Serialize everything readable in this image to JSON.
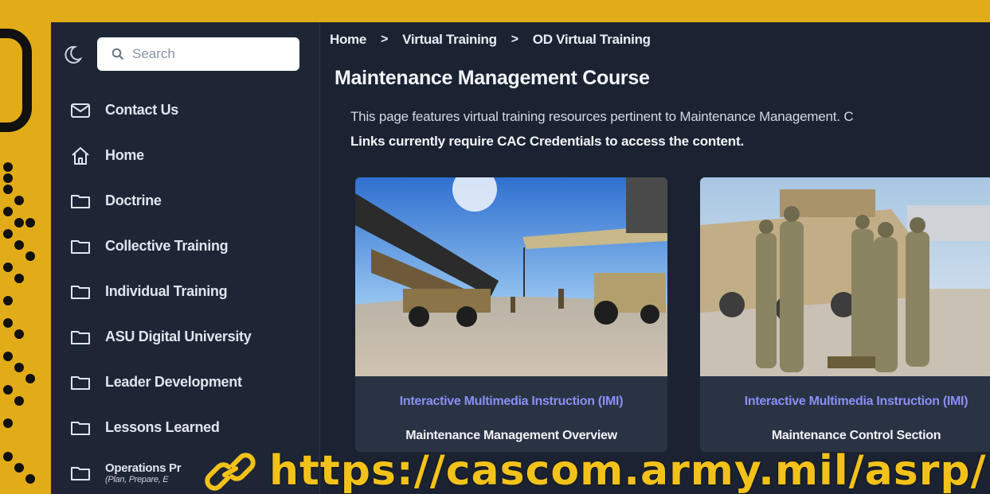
{
  "search": {
    "placeholder": "Search"
  },
  "icons": {
    "theme": "moon-icon",
    "search": "search-icon",
    "contact": "envelope-icon",
    "home": "home-icon",
    "folder": "folder-icon",
    "link": "link-icon"
  },
  "sidebar": {
    "items": [
      {
        "label": "Contact Us",
        "icon": "envelope-icon"
      },
      {
        "label": "Home",
        "icon": "home-icon"
      },
      {
        "label": "Doctrine",
        "icon": "folder-icon"
      },
      {
        "label": "Collective Training",
        "icon": "folder-icon"
      },
      {
        "label": "Individual Training",
        "icon": "folder-icon"
      },
      {
        "label": "ASU Digital University",
        "icon": "folder-icon"
      },
      {
        "label": "Leader Development",
        "icon": "folder-icon"
      },
      {
        "label": "Lessons Learned",
        "icon": "folder-icon"
      },
      {
        "label": "Operations Pr",
        "sub": "(Plan, Prepare, E",
        "icon": "folder-icon"
      }
    ]
  },
  "breadcrumb": {
    "items": [
      "Home",
      "Virtual Training",
      "OD Virtual Training"
    ],
    "separator": ">"
  },
  "main": {
    "title": "Maintenance Management Course",
    "description": "This page features virtual training resources pertinent to Maintenance Management. C",
    "notice": "Links currently require CAC Credentials to access the content.",
    "cards": [
      {
        "category": "Interactive Multimedia Instruction (IMI)",
        "title": "Maintenance Management Overview"
      },
      {
        "category": "Interactive Multimedia Instruction (IMI)",
        "title": "Maintenance Control Section"
      }
    ]
  },
  "banner": {
    "url": "https://cascom.army.mil/asrp/"
  },
  "colors": {
    "frame": "#e2ac18",
    "sidebar_bg": "#1e2636",
    "main_bg": "#1b2333",
    "card_bg": "#2a3344",
    "link_accent": "#8c8ef6",
    "url_yellow": "#f2c21a"
  }
}
